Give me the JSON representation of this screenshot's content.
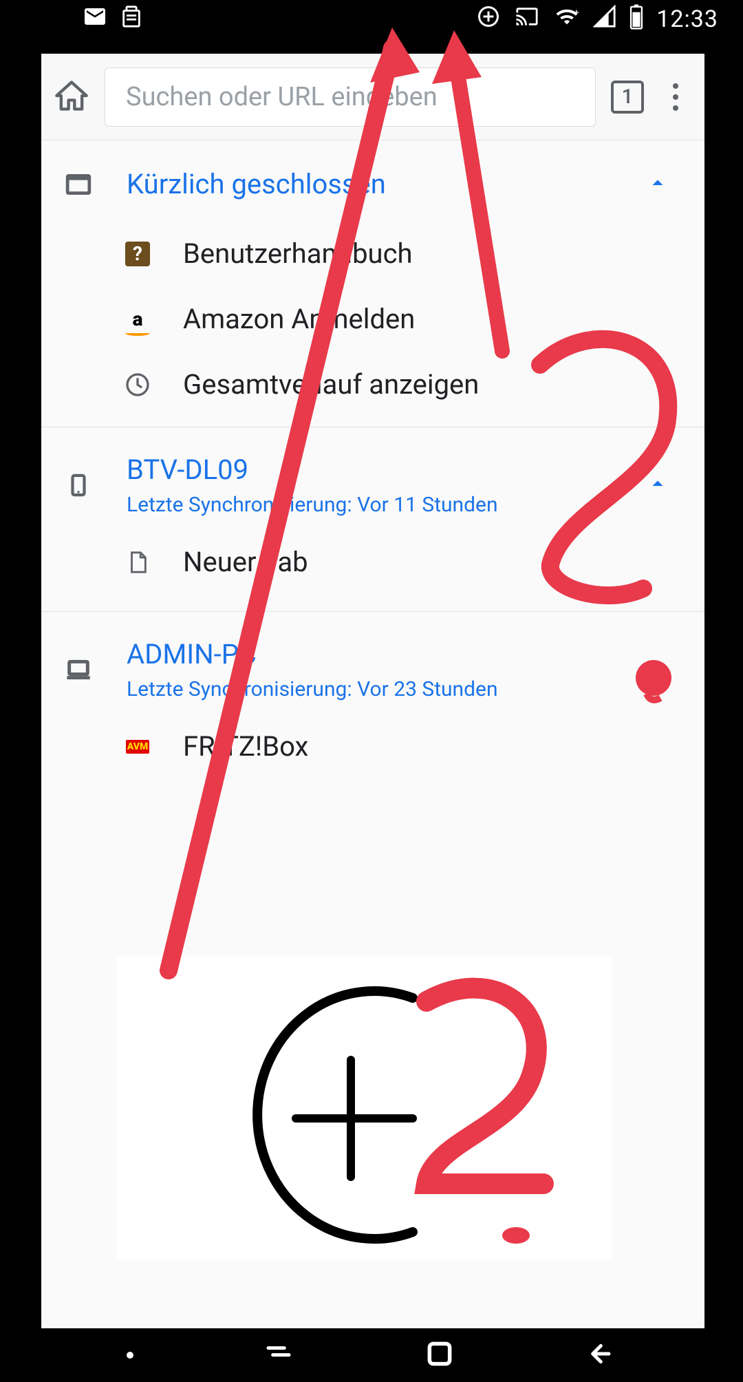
{
  "statusbar": {
    "time": "12:33"
  },
  "toolbar": {
    "url_placeholder": "Suchen oder URL eingeben",
    "tab_count": "1"
  },
  "recent": {
    "title": "Kürzlich geschlossen",
    "items": [
      {
        "label": "Benutzerhandbuch"
      },
      {
        "label": "Amazon Anmelden"
      }
    ],
    "full_history": "Gesamtverlauf anzeigen"
  },
  "devices": [
    {
      "name": "BTV-DL09",
      "sync": "Letzte Synchronisierung: Vor 11 Stunden",
      "tabs": [
        {
          "label": "Neuer Tab"
        }
      ]
    },
    {
      "name": "ADMIN-PC",
      "sync": "Letzte Synchronisierung: Vor 23 Stunden",
      "tabs": [
        {
          "label": "FRITZ!Box"
        }
      ]
    }
  ],
  "annotation": {
    "symbol_hint": "C+",
    "question_mark": "?"
  }
}
